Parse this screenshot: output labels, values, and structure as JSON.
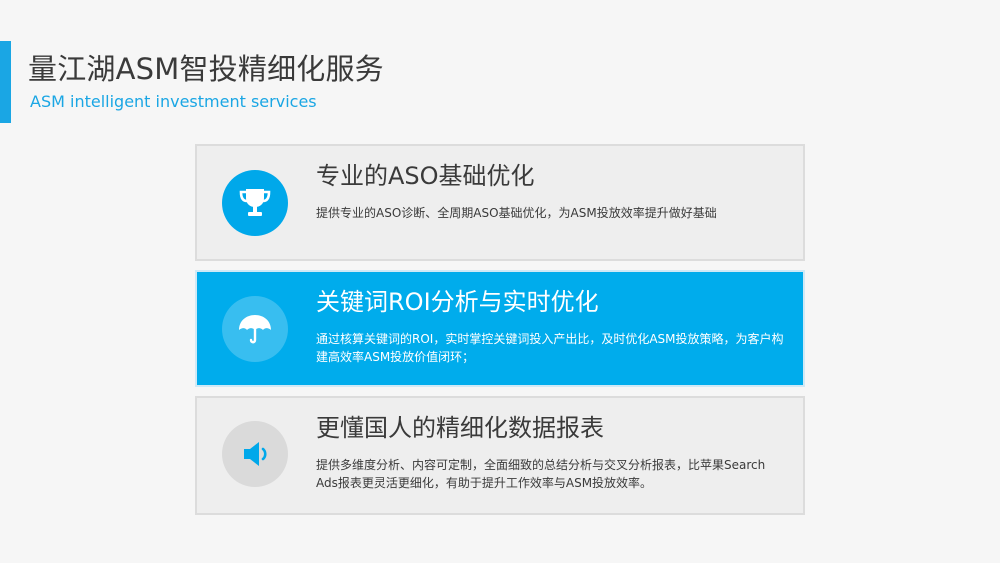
{
  "header": {
    "title": "量江湖ASM智投精细化服务",
    "subtitle": "ASM intelligent investment services"
  },
  "colors": {
    "accent": "#1aa6e4",
    "active_card": "#00acec",
    "card_bg": "#eeeeee"
  },
  "cards": [
    {
      "icon": "trophy-icon",
      "title": "专业的ASO基础优化",
      "desc": "提供专业的ASO诊断、全周期ASO基础优化，为ASM投放效率提升做好基础"
    },
    {
      "icon": "umbrella-icon",
      "title": "关键词ROI分析与实时优化",
      "desc": "通过核算关键词的ROI，实时掌控关键词投入产出比，及时优化ASM投放策略，为客户构建高效率ASM投放价值闭环；"
    },
    {
      "icon": "speaker-icon",
      "title": "更懂国人的精细化数据报表",
      "desc": "提供多维度分析、内容可定制，全面细致的总结分析与交叉分析报表，比苹果Search Ads报表更灵活更细化，有助于提升工作效率与ASM投放效率。"
    }
  ]
}
